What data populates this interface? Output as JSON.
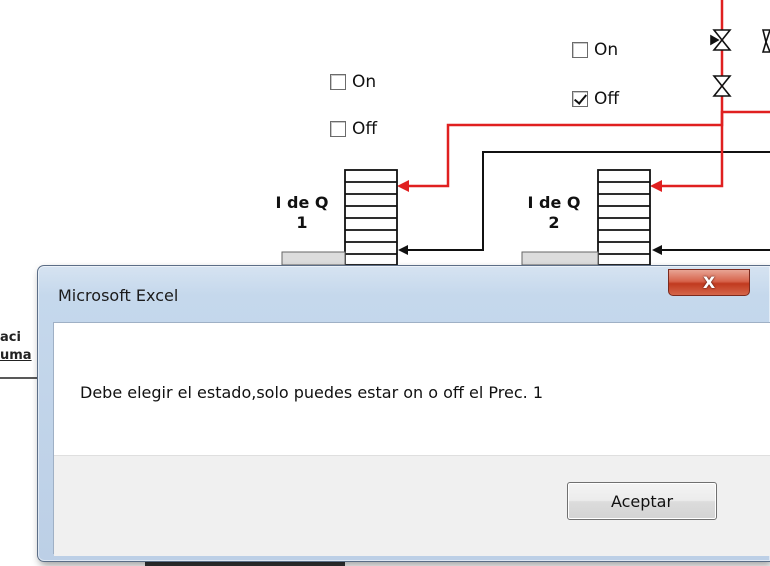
{
  "background": {
    "checkbox_group_1": {
      "on_label": "On",
      "off_label": "Off",
      "on_checked": false,
      "off_checked": false
    },
    "checkbox_group_2": {
      "on_label": "On",
      "off_label": "Off",
      "on_checked": false,
      "off_checked": true
    },
    "unit_1": {
      "label": "I de Q",
      "number": "1"
    },
    "unit_2": {
      "label": "I de Q",
      "number": "2"
    },
    "side_text_1": "aci",
    "side_text_2": "uma",
    "pipe_color": "#e02020",
    "line_color": "#111111"
  },
  "dialog": {
    "title": "Microsoft Excel",
    "close_label": "X",
    "message": "Debe elegir el estado,solo puedes estar on o off el Prec. 1",
    "ok_label": "Aceptar"
  }
}
